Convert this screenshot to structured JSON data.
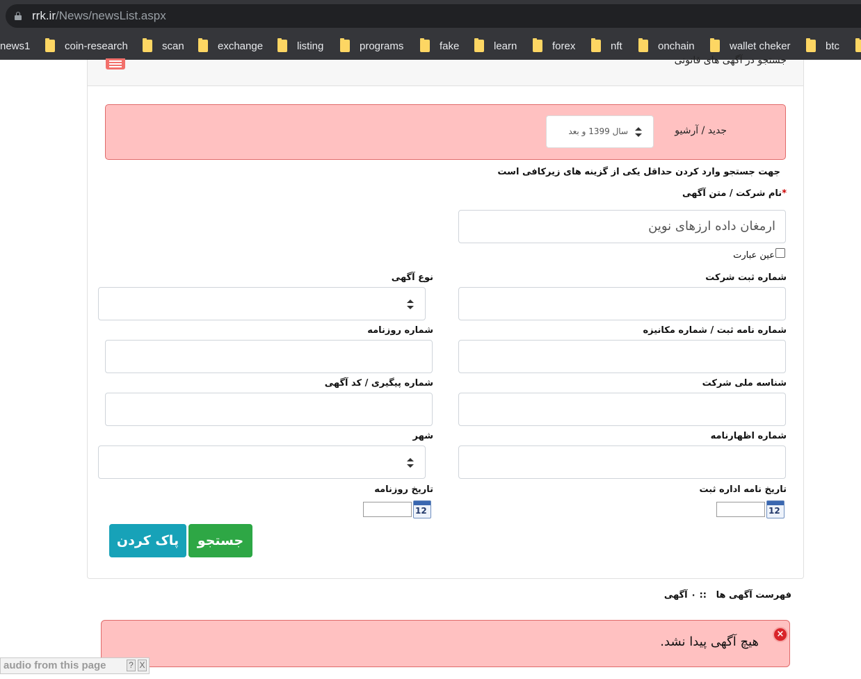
{
  "browser": {
    "url_host": "rrk.ir",
    "url_path": "/News/newsList.aspx",
    "bookmarks": [
      "news1",
      "coin-research",
      "scan",
      "exchange",
      "listing",
      "programs",
      "fake",
      "learn",
      "forex",
      "nft",
      "onchain",
      "wallet cheker",
      "btc"
    ]
  },
  "panel": {
    "title": "جستجو در آگهی های قانونی",
    "archive_label": "جدید / آرشیو",
    "archive_value": "سال 1399 و بعد",
    "hint": "جهت جستجو وارد کردن حداقل یکی از گزینه های زیرکافی است",
    "name_label": "نام شرکت / متن آگهی",
    "required_mark": "*",
    "name_value": "ارمغان داده ارزهای نوین",
    "exact_label": "عین عبارت",
    "fields": {
      "company_reg_number": "شماره ثبت شرکت",
      "ad_type": "نوع آگهی",
      "letter_number": "شماره نامه ثبت / شماره مکانیزه",
      "newspaper_number": "شماره روزنامه",
      "national_id": "شناسه ملی شرکت",
      "tracking_code": "شماره پیگیری / کد آگهی",
      "declaration_number": "شماره اظهارنامه",
      "city": "شهر",
      "letter_date": "تاریخ نامه اداره ثبت",
      "newspaper_date": "تاریخ روزنامه"
    },
    "calendar_number": "12",
    "search_button": "جستجو",
    "clear_button": "پاک کردن"
  },
  "results": {
    "title": "فهرست آگهی ها",
    "count": ":: ۰ آگهی",
    "empty_message": "هیچ آگهی پیدا نشد.",
    "error_icon": "×"
  },
  "audio_bar": {
    "text": "audio from this page",
    "help": "?",
    "close": "X"
  }
}
